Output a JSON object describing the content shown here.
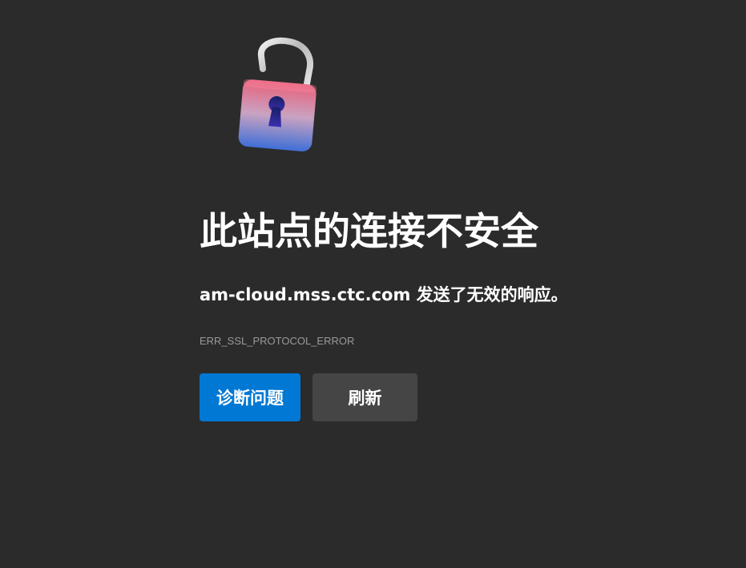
{
  "error_page": {
    "lock_icon": "unlocked-padlock-icon",
    "headline": "此站点的连接不安全",
    "description": "am-cloud.mss.ctc.com 发送了无效的响应。",
    "error_code": "ERR_SSL_PROTOCOL_ERROR",
    "buttons": {
      "diagnose_label": "诊断问题",
      "refresh_label": "刷新"
    }
  },
  "colors": {
    "background": "#2b2b2b",
    "primary_button": "#0078d4",
    "secondary_button": "#454545",
    "error_code_text": "#9a9a9a"
  }
}
